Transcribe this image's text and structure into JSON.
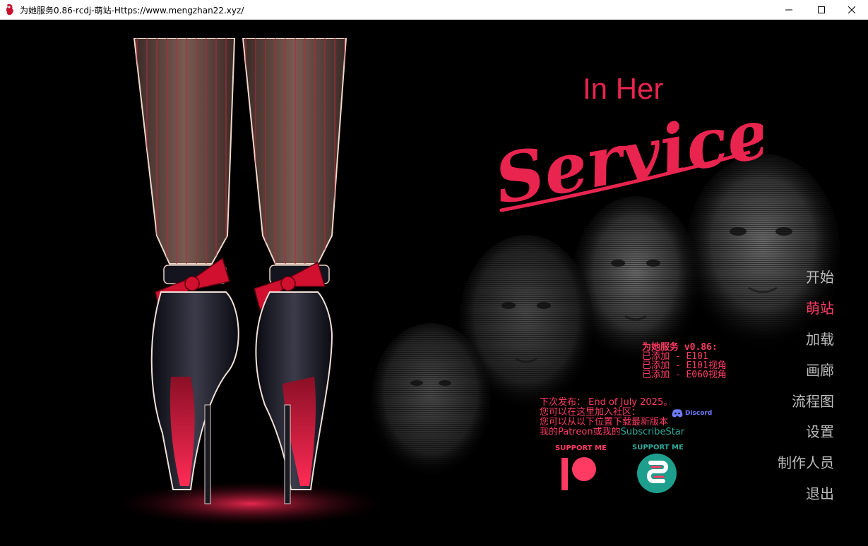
{
  "window": {
    "title": "为她服务0.86-rcdj-萌站-Https://www.mengzhan22.xyz/"
  },
  "logo": {
    "line1": "In Her",
    "line2": "Service",
    "color": "#e8244f"
  },
  "menu": {
    "items": [
      {
        "label": "开始",
        "active": false
      },
      {
        "label": "萌站",
        "active": true
      },
      {
        "label": "加载",
        "active": false
      },
      {
        "label": "画廊",
        "active": false
      },
      {
        "label": "流程图",
        "active": false
      },
      {
        "label": "设置",
        "active": false
      },
      {
        "label": "制作人员",
        "active": false
      },
      {
        "label": "退出",
        "active": false
      }
    ]
  },
  "patch_notes": {
    "heading": "为她服务 v0.86:",
    "lines": [
      "已添加 - E101",
      "已添加 - E101视角",
      "已添加 - E060视角"
    ]
  },
  "info": {
    "next_release": "下次发布： End of July 2025。",
    "community": "您可以在这里加入社区：",
    "download": "您可以从以下位置下载最新版本",
    "support_prefix": "我的Patreon或我的",
    "support_link": "SubscribeStar"
  },
  "discord": {
    "label": "Discord"
  },
  "patreon": {
    "label": "SUPPORT ME"
  },
  "subscribestar": {
    "label": "SUPPORT ME"
  },
  "colors": {
    "accent": "#ff3b63",
    "menu_text": "#bdbdbd",
    "teal": "#2fa99a",
    "discord": "#6d7bff"
  }
}
